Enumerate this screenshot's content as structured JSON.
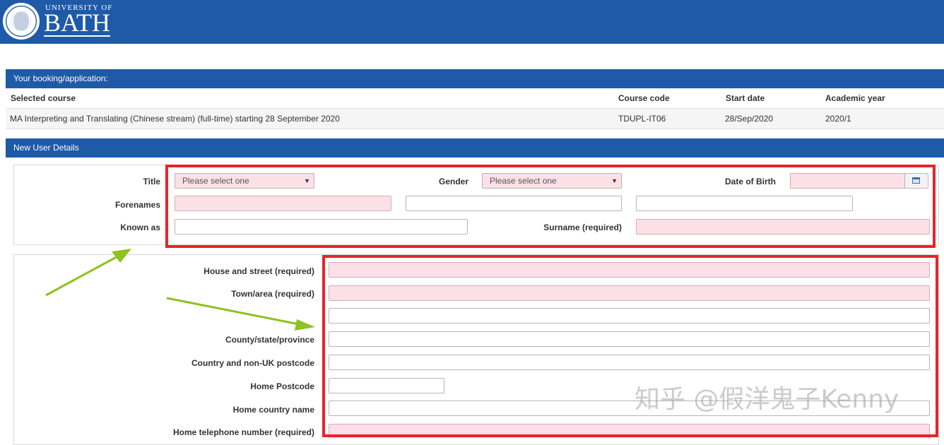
{
  "header": {
    "university_of": "UNIVERSITY OF",
    "bath": "BATH"
  },
  "booking": {
    "heading": "Your booking/application:",
    "columns": [
      "Selected course",
      "Course code",
      "Start date",
      "Academic year"
    ],
    "row": [
      "MA Interpreting and Translating (Chinese stream) (full-time) starting 28 September 2020",
      "TDUPL-IT06",
      "28/Sep/2020",
      "2020/1"
    ]
  },
  "new_user": {
    "heading": "New User Details",
    "labels": {
      "title": "Title",
      "gender": "Gender",
      "dob": "Date of Birth",
      "forenames": "Forenames",
      "known_as": "Known as",
      "surname": "Surname (required)",
      "house_street": "House and street (required)",
      "town": "Town/area (required)",
      "county": "County/state/province",
      "country_postcode": "Country and non-UK postcode",
      "home_postcode": "Home Postcode",
      "home_country": "Home country name",
      "home_phone": "Home telephone number (required)"
    },
    "title_select": "Please select one",
    "gender_select": "Please select one"
  },
  "watermark": "知乎 @假洋鬼子Kenny",
  "colors": {
    "brand_blue": "#1f5aa8",
    "required_pink": "#fce0e8",
    "annotation_red": "#e3262b",
    "arrow_green": "#8dc21f"
  }
}
